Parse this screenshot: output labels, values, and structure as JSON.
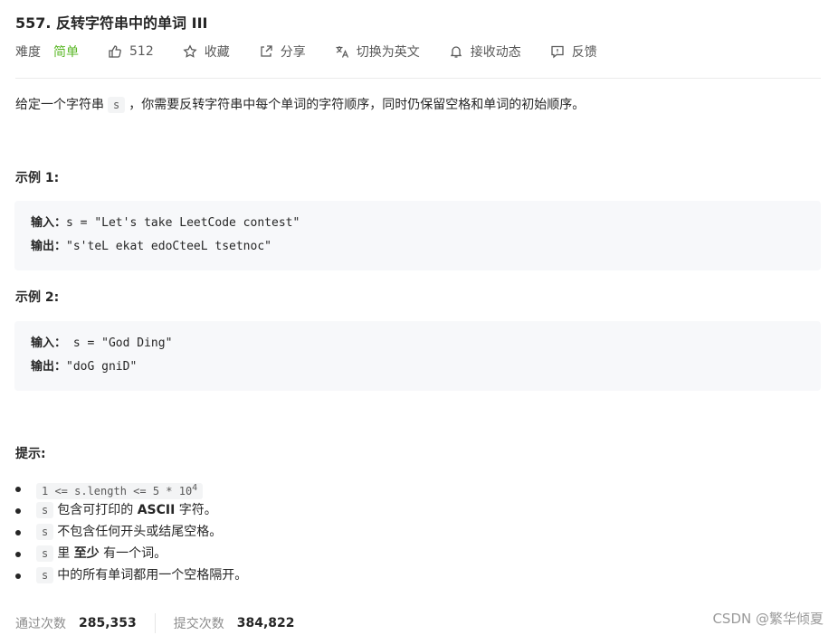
{
  "problem": {
    "title": "557. 反转字符串中的单词 III"
  },
  "meta": {
    "difficulty_label": "难度",
    "difficulty_value": "简单",
    "difficulty_color": "#5ab726",
    "likes": "512",
    "favorite": "收藏",
    "share": "分享",
    "translate": "切换为英文",
    "subscribe": "接收动态",
    "feedback": "反馈"
  },
  "description": {
    "prefix": "给定一个字符串",
    "var": "s",
    "suffix": "，你需要反转字符串中每个单词的字符顺序，同时仍保留空格和单词的初始顺序。"
  },
  "examples": [
    {
      "heading": "示例 1:",
      "input_label": "输入：",
      "input_value": "s = \"Let's take LeetCode contest\"",
      "output_label": "输出：",
      "output_value": "\"s'teL ekat edoCteeL tsetnoc\""
    },
    {
      "heading": "示例 2:",
      "input_label": "输入：",
      "input_value": " s = \"God Ding\"",
      "output_label": "输出：",
      "output_value": "\"doG gniD\""
    }
  ],
  "tips": {
    "heading": "提示:",
    "items": [
      {
        "code": "1 <= s.length <= 5 * 10",
        "sup": "4"
      },
      {
        "code": "s",
        "before": "包含可打印的 ",
        "bold": "ASCII",
        "after": " 字符。"
      },
      {
        "code": "s",
        "text": "不包含任何开头或结尾空格。"
      },
      {
        "code": "s",
        "before": "里 ",
        "bold": "至少",
        "after": " 有一个词。"
      },
      {
        "code": "s",
        "text": "中的所有单词都用一个空格隔开。"
      }
    ]
  },
  "footer": {
    "accepted_label": "通过次数",
    "accepted_value": "285,353",
    "submissions_label": "提交次数",
    "submissions_value": "384,822"
  },
  "watermark": "CSDN @繁华倾夏"
}
